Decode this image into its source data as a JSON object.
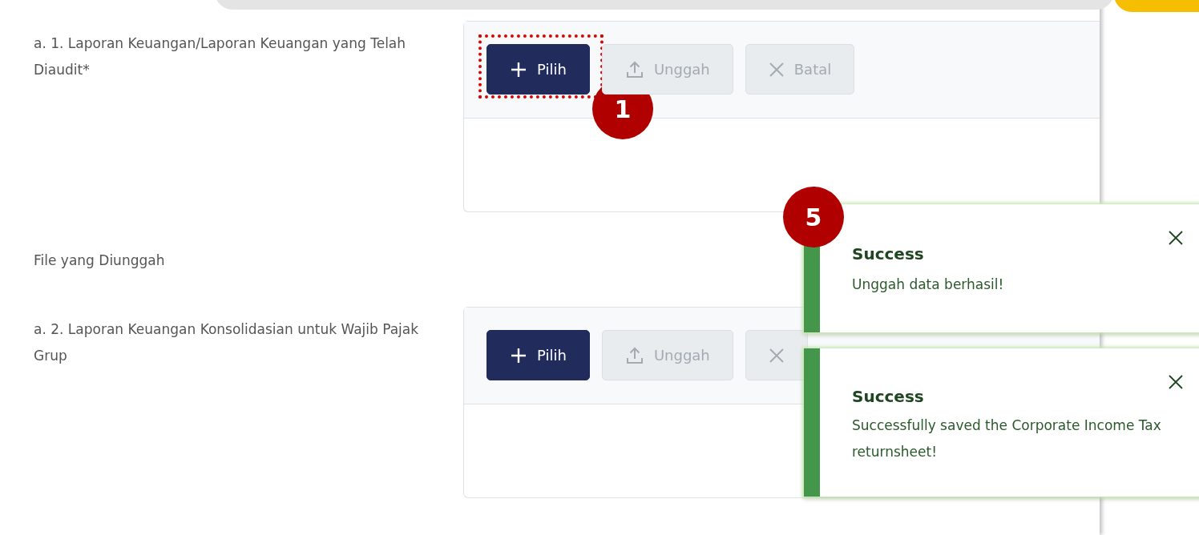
{
  "sections": [
    {
      "label": "a. 1. Laporan Keuangan/Laporan Keuangan yang Telah Diaudit*",
      "highlighted": true,
      "step": "1",
      "buttons": [
        {
          "kind": "choose",
          "label": "Pilih",
          "disabled": false
        },
        {
          "kind": "upload",
          "label": "Unggah",
          "disabled": true
        },
        {
          "kind": "cancel",
          "label": "Batal",
          "disabled": true
        }
      ],
      "note": "File yang Diunggah"
    },
    {
      "label": "a. 2. Laporan Keuangan Konsolidasian untuk Wajib Pajak Grup",
      "highlighted": false,
      "buttons": [
        {
          "kind": "choose",
          "label": "Pilih",
          "disabled": false
        },
        {
          "kind": "upload",
          "label": "Unggah",
          "disabled": true
        },
        {
          "kind": "cancel",
          "disabled": true
        }
      ]
    }
  ],
  "toast_step": "5",
  "toasts": [
    {
      "title": "Success",
      "message": "Unggah data berhasil!"
    },
    {
      "title": "Success",
      "message": "Successfully saved the Corporate Income Tax returnsheet!"
    }
  ]
}
